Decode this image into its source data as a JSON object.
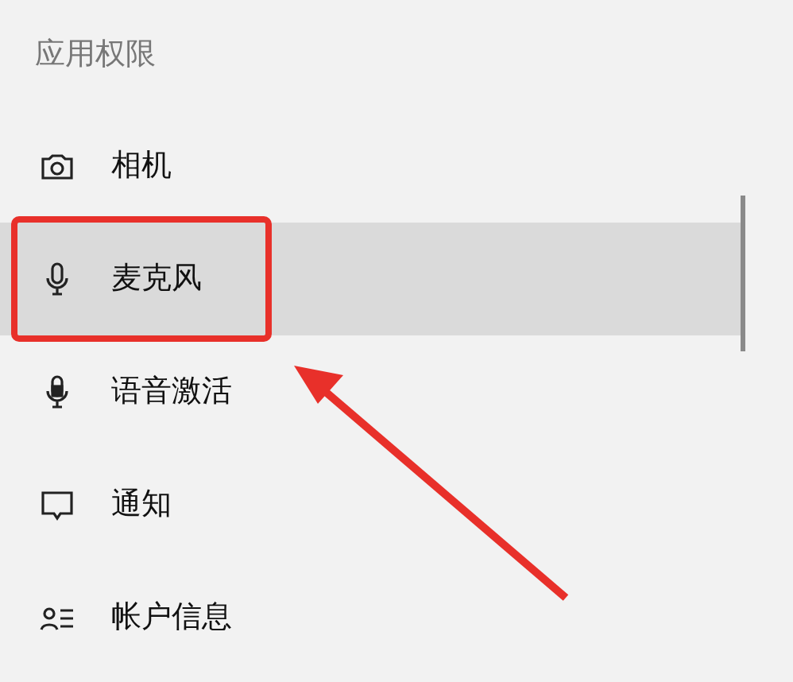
{
  "section_title": "应用权限",
  "items": [
    {
      "kind": "camera",
      "label": "相机",
      "selected": false,
      "highlighted": false
    },
    {
      "kind": "microphone",
      "label": "麦克风",
      "selected": true,
      "highlighted": true
    },
    {
      "kind": "voice",
      "label": "语音激活",
      "selected": false,
      "highlighted": false
    },
    {
      "kind": "notification",
      "label": "通知",
      "selected": false,
      "highlighted": false
    },
    {
      "kind": "account",
      "label": "帐户信息",
      "selected": false,
      "highlighted": false
    }
  ]
}
